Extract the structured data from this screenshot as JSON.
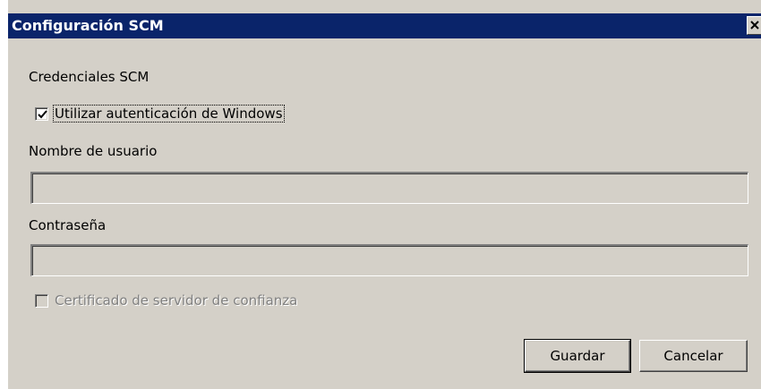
{
  "window": {
    "title": "Configuración SCM",
    "close_glyph": "✕"
  },
  "section": {
    "credentials_label": "Credenciales SCM"
  },
  "use_windows_auth": {
    "label": "Utilizar autenticación de Windows",
    "checked": true
  },
  "username": {
    "label": "Nombre de usuario",
    "value": ""
  },
  "password": {
    "label": "Contraseña",
    "value": ""
  },
  "trusted_cert": {
    "label": "Certificado de servidor de confianza",
    "checked": false,
    "disabled": true
  },
  "buttons": {
    "save": "Guardar",
    "cancel": "Cancelar"
  },
  "colors": {
    "titlebar": "#0a246a",
    "dialog_face": "#d4d0c8",
    "disabled_text": "#808080"
  },
  "icons": {
    "close": "close-icon",
    "check": "checkmark-icon"
  }
}
